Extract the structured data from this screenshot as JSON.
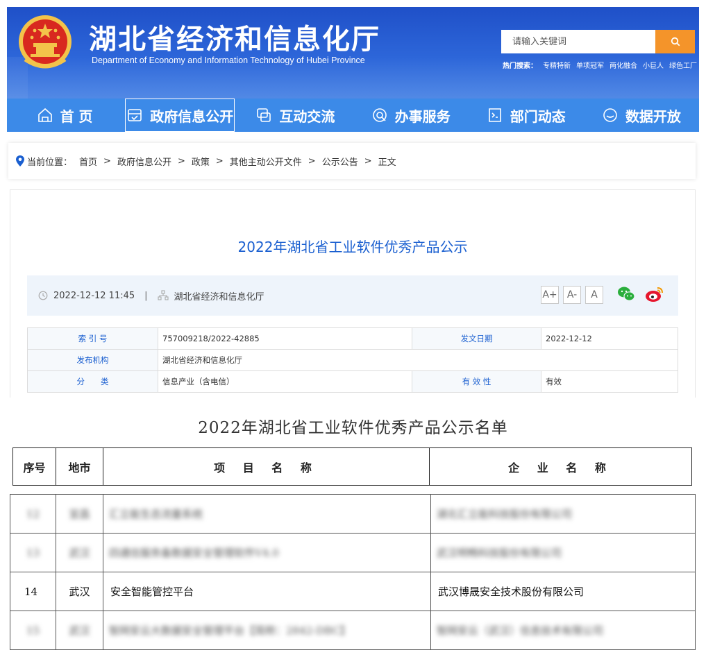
{
  "header": {
    "site_title": "湖北省经济和信息化厅",
    "site_subtitle": "Department of Economy and Information Technology of Hubei Province",
    "search_placeholder": "请输入关键词",
    "hot_label": "热门搜索：",
    "hot_items": [
      "专精特新",
      "单项冠军",
      "两化融合",
      "小巨人",
      "绿色工厂"
    ]
  },
  "nav": {
    "items": [
      {
        "label": "首 页",
        "icon": "home-icon"
      },
      {
        "label": "政府信息公开",
        "icon": "inbox-check-icon"
      },
      {
        "label": "互动交流",
        "icon": "chat-icon"
      },
      {
        "label": "办事服务",
        "icon": "service-icon"
      },
      {
        "label": "部门动态",
        "icon": "news-icon"
      },
      {
        "label": "数据开放",
        "icon": "smile-icon"
      }
    ],
    "active_index": 1
  },
  "breadcrumb": {
    "label": "当前位置：",
    "items": [
      "首页",
      "政府信息公开",
      "政策",
      "其他主动公开文件",
      "公示公告",
      "正文"
    ],
    "separator": ">"
  },
  "article": {
    "title": "2022年湖北省工业软件优秀产品公示",
    "date": "2022-12-12 11:45",
    "pipe": "|",
    "publisher": "湖北省经济和信息化厅",
    "font_sizes": [
      "A+",
      "A-",
      "A"
    ],
    "info": {
      "index_label": "索 引 号",
      "index_value": "757009218/2022-42885",
      "issue_date_label": "发文日期",
      "issue_date_value": "2022-12-12",
      "org_label": "发布机构",
      "org_value": "湖北省经济和信息化厅",
      "category_label": "分　　类",
      "category_value": "信息产业（含电信）",
      "validity_label": "有 效 性",
      "validity_value": "有效"
    }
  },
  "list": {
    "title": "2022年湖北省工业软件优秀产品公示名单",
    "headers": [
      "序号",
      "地市",
      "项 目 名 称",
      "企 业 名 称"
    ],
    "rows": [
      {
        "no": "12",
        "city": "宜昌",
        "project": "汇立能生态流量系统",
        "company": "湖北汇立能科技股份有限公司",
        "blurred": true
      },
      {
        "no": "13",
        "city": "武汉",
        "project": "四通信服务备数据安全管理软件V4.0",
        "company": "武汉明畅科技股份有限公司",
        "blurred": true
      },
      {
        "no": "14",
        "city": "武汉",
        "project": "安全智能管控平台",
        "company": "武汉博晟安全技术股份有限公司",
        "blurred": false
      },
      {
        "no": "15",
        "city": "武汉",
        "project": "智网安云大数据安全管理平台【简称：2842-DBC】",
        "company": "智网安云（武汉）信息技术有限公司",
        "blurred": true
      }
    ]
  }
}
